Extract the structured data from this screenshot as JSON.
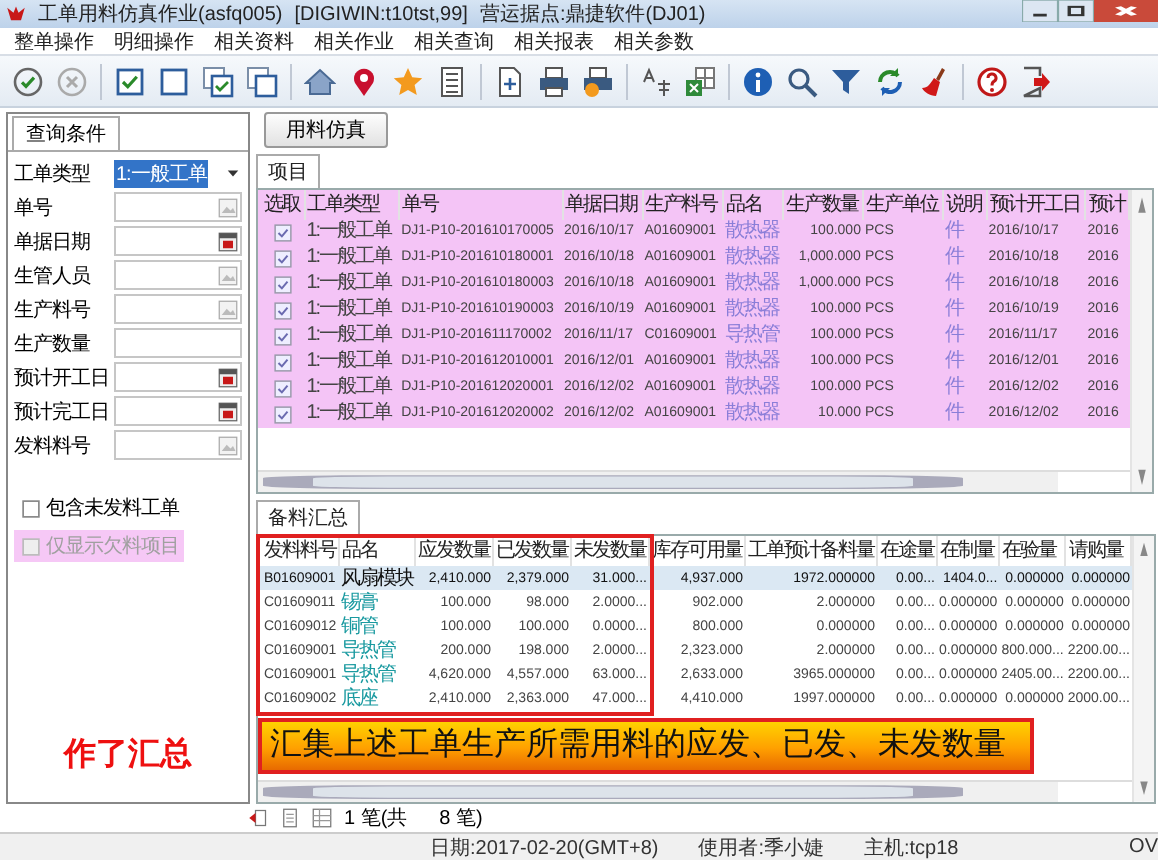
{
  "window": {
    "title": "工单用料仿真作业(asfq005)",
    "session": "[DIGIWIN:t10tst,99]",
    "site": "营运据点:鼎捷软件(DJ01)"
  },
  "menu": [
    "整单操作",
    "明细操作",
    "相关资料",
    "相关作业",
    "相关查询",
    "相关报表",
    "相关参数"
  ],
  "query_panel": {
    "tab": "查询条件",
    "fields": [
      {
        "label": "工单类型",
        "value": "1:一般工单",
        "kind": "dropdown"
      },
      {
        "label": "单号",
        "kind": "lookup"
      },
      {
        "label": "单据日期",
        "kind": "date"
      },
      {
        "label": "生管人员",
        "kind": "lookup"
      },
      {
        "label": "生产料号",
        "kind": "lookup"
      },
      {
        "label": "生产数量",
        "kind": "text"
      },
      {
        "label": "预计开工日",
        "kind": "date"
      },
      {
        "label": "预计完工日",
        "kind": "date"
      },
      {
        "label": "发料料号",
        "kind": "lookup"
      }
    ],
    "checkboxes": [
      {
        "label": "包含未发料工单",
        "checked": false,
        "disabled": false,
        "highlighted": false
      },
      {
        "label": "仅显示欠料项目",
        "checked": false,
        "disabled": true,
        "highlighted": true
      }
    ]
  },
  "simulate_button": "用料仿真",
  "items_tab": "项目",
  "items_table": {
    "highlighted": true,
    "columns": [
      {
        "label": "选取",
        "kind": "check"
      },
      {
        "label": "工单类型",
        "kind": "text"
      },
      {
        "label": "单号",
        "kind": "code"
      },
      {
        "label": "单据日期",
        "kind": "code"
      },
      {
        "label": "生产料号",
        "kind": "code"
      },
      {
        "label": "品名",
        "kind": "link"
      },
      {
        "label": "生产数量",
        "kind": "number"
      },
      {
        "label": "生产单位",
        "kind": "code"
      },
      {
        "label": "说明",
        "kind": "link"
      },
      {
        "label": "预计开工日",
        "kind": "code"
      },
      {
        "label": "预计",
        "kind": "code"
      }
    ],
    "rows": [
      {
        "cells": [
          {
            "checked": true
          },
          "1:一般工单",
          "DJ1-P10-201610170005",
          "2016/10/17",
          "A01609001",
          "散热器",
          "100.000",
          "PCS",
          "件",
          "2016/10/17",
          "2016"
        ]
      },
      {
        "cells": [
          {
            "checked": true
          },
          "1:一般工单",
          "DJ1-P10-201610180001",
          "2016/10/18",
          "A01609001",
          "散热器",
          "1,000.000",
          "PCS",
          "件",
          "2016/10/18",
          "2016"
        ]
      },
      {
        "cells": [
          {
            "checked": true
          },
          "1:一般工单",
          "DJ1-P10-201610180003",
          "2016/10/18",
          "A01609001",
          "散热器",
          "1,000.000",
          "PCS",
          "件",
          "2016/10/18",
          "2016"
        ]
      },
      {
        "cells": [
          {
            "checked": true
          },
          "1:一般工单",
          "DJ1-P10-201610190003",
          "2016/10/19",
          "A01609001",
          "散热器",
          "100.000",
          "PCS",
          "件",
          "2016/10/19",
          "2016"
        ]
      },
      {
        "cells": [
          {
            "checked": true
          },
          "1:一般工单",
          "DJ1-P10-201611170002",
          "2016/11/17",
          "C01609001",
          "导热管",
          "100.000",
          "PCS",
          "件",
          "2016/11/17",
          "2016"
        ]
      },
      {
        "cells": [
          {
            "checked": true
          },
          "1:一般工单",
          "DJ1-P10-201612010001",
          "2016/12/01",
          "A01609001",
          "散热器",
          "100.000",
          "PCS",
          "件",
          "2016/12/01",
          "2016"
        ]
      },
      {
        "cells": [
          {
            "checked": true
          },
          "1:一般工单",
          "DJ1-P10-201612020001",
          "2016/12/02",
          "A01609001",
          "散热器",
          "100.000",
          "PCS",
          "件",
          "2016/12/02",
          "2016"
        ]
      },
      {
        "cells": [
          {
            "checked": true
          },
          "1:一般工单",
          "DJ1-P10-201612020002",
          "2016/12/02",
          "A01609001",
          "散热器",
          "10.000",
          "PCS",
          "件",
          "2016/12/02",
          "2016"
        ]
      }
    ]
  },
  "summary_tab": "备料汇总",
  "summary_table": {
    "columns": [
      {
        "label": "发料料号",
        "kind": "code"
      },
      {
        "label": "品名",
        "kind": "link"
      },
      {
        "label": "应发数量",
        "kind": "number"
      },
      {
        "label": "已发数量",
        "kind": "number"
      },
      {
        "label": "未发数量",
        "kind": "number"
      },
      {
        "label": "库存可用量",
        "kind": "number"
      },
      {
        "label": "工单预计备料量",
        "kind": "number"
      },
      {
        "label": "在途量",
        "kind": "number"
      },
      {
        "label": "在制量",
        "kind": "number"
      },
      {
        "label": "在验量",
        "kind": "number"
      },
      {
        "label": "请购量",
        "kind": "number"
      }
    ],
    "rows": [
      {
        "selected": true,
        "cells": [
          "B01609001",
          "风扇模块",
          "2,410.000",
          "2,379.000",
          "31.000...",
          "4,937.000",
          "1972.000000",
          "0.00...",
          "1404.0...",
          "0.000000",
          "0.000000"
        ]
      },
      {
        "selected": false,
        "cells": [
          "C01609011",
          "锡膏",
          "100.000",
          "98.000",
          "2.0000...",
          "902.000",
          "2.000000",
          "0.00...",
          "0.000000",
          "0.000000",
          "0.000000"
        ]
      },
      {
        "selected": false,
        "cells": [
          "C01609012",
          "铜管",
          "100.000",
          "100.000",
          "0.0000...",
          "800.000",
          "0.000000",
          "0.00...",
          "0.000000",
          "0.000000",
          "0.000000"
        ]
      },
      {
        "selected": false,
        "cells": [
          "C01609001",
          "导热管",
          "200.000",
          "198.000",
          "2.0000...",
          "2,323.000",
          "2.000000",
          "0.00...",
          "0.000000",
          "800.000...",
          "2200.00..."
        ]
      },
      {
        "selected": false,
        "cells": [
          "C01609001",
          "导热管",
          "4,620.000",
          "4,557.000",
          "63.000...",
          "2,633.000",
          "3965.000000",
          "0.00...",
          "0.000000",
          "2405.00...",
          "2200.00..."
        ]
      },
      {
        "selected": false,
        "cells": [
          "C01609002",
          "底座",
          "2,410.000",
          "2,363.000",
          "47.000...",
          "4,410.000",
          "1997.000000",
          "0.00...",
          "0.000000",
          "0.000000",
          "2000.00..."
        ]
      }
    ]
  },
  "annotations": [
    {
      "kind": "note",
      "text": "作了汇总"
    },
    {
      "kind": "frame"
    },
    {
      "kind": "banner",
      "text": "汇集上述工单生产所需用料的应发、已发、未发数量"
    }
  ],
  "pager": {
    "current": "1 笔(共",
    "total": "8 笔)"
  },
  "status_bar": [
    "日期:2017-02-20(GMT+8)",
    "使用者:季小婕",
    "主机:tcp18",
    "OV"
  ]
}
